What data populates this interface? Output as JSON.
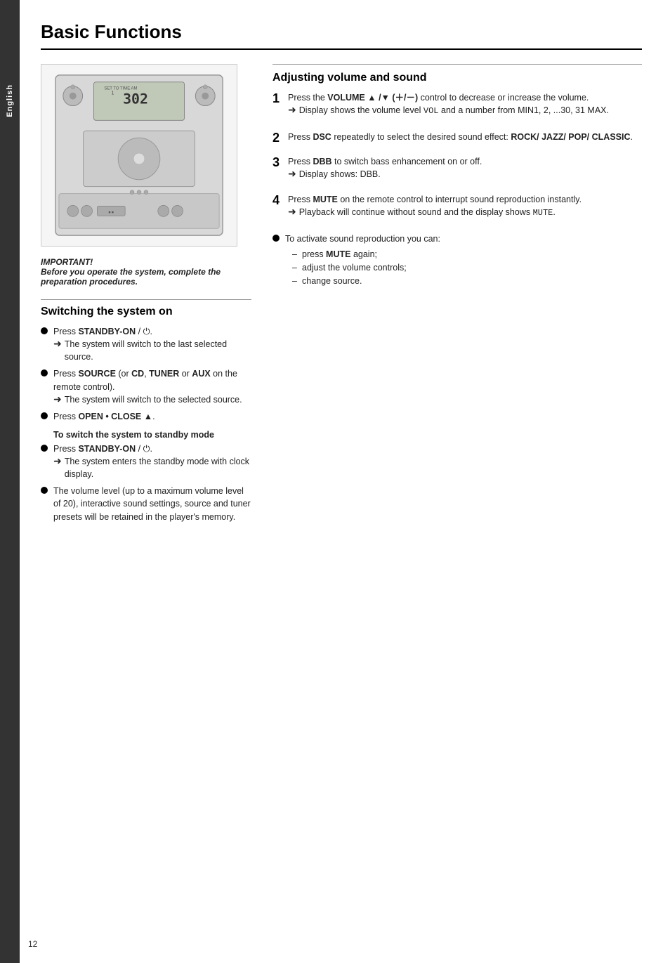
{
  "page": {
    "title": "Basic Functions",
    "number": "12",
    "language_tab": "English"
  },
  "left_column": {
    "important": {
      "title": "IMPORTANT!",
      "body": "Before you operate the system, complete the preparation procedures."
    },
    "switching_section": {
      "heading": "Switching the system on",
      "bullets": [
        {
          "text_parts": [
            {
              "text": "Press ",
              "bold": false
            },
            {
              "text": "STANDBY-ON",
              "bold": true
            },
            {
              "text": " / ⏻.",
              "bold": false
            }
          ],
          "arrow": "The system will switch to the last selected source."
        },
        {
          "text_parts": [
            {
              "text": "Press ",
              "bold": false
            },
            {
              "text": "SOURCE",
              "bold": true
            },
            {
              "text": " (or ",
              "bold": false
            },
            {
              "text": "CD",
              "bold": true
            },
            {
              "text": ", ",
              "bold": false
            },
            {
              "text": "TUNER",
              "bold": true
            },
            {
              "text": " or ",
              "bold": false
            },
            {
              "text": "AUX",
              "bold": true
            },
            {
              "text": " on the remote control).",
              "bold": false
            }
          ],
          "arrow": "The system will switch to the selected source."
        },
        {
          "text_parts": [
            {
              "text": "Press ",
              "bold": false
            },
            {
              "text": "OPEN • CLOSE",
              "bold": true
            },
            {
              "text": " ▲.",
              "bold": false
            }
          ],
          "arrow": null
        }
      ],
      "standby_subheading": "To switch the system to standby mode",
      "standby_bullets": [
        {
          "text_parts": [
            {
              "text": "Press ",
              "bold": false
            },
            {
              "text": "STANDBY-ON",
              "bold": true
            },
            {
              "text": " / ⏻.",
              "bold": false
            }
          ],
          "arrow": "The system enters the standby mode with clock display."
        },
        {
          "text_parts": [
            {
              "text": "The volume level (up to a maximum volume level of 20), interactive sound settings, source and tuner presets will be retained in the player's memory.",
              "bold": false
            }
          ],
          "arrow": null
        }
      ]
    }
  },
  "right_column": {
    "heading": "Adjusting volume and sound",
    "steps": [
      {
        "num": "1",
        "text_parts": [
          {
            "text": "Press the ",
            "bold": false
          },
          {
            "text": "VOLUME ▲ /▼ (＋/－)",
            "bold": true
          },
          {
            "text": " control to decrease or increase the volume.",
            "bold": false
          }
        ],
        "arrow": "Display shows the volume level VOL and a number from MIN1, 2, ...30, 31 MAX."
      },
      {
        "num": "2",
        "text_parts": [
          {
            "text": "Press ",
            "bold": false
          },
          {
            "text": "DSC",
            "bold": true
          },
          {
            "text": " repeatedly to select the desired sound effect: ",
            "bold": false
          },
          {
            "text": "ROCK/ JAZZ/ POP/ CLASSIC",
            "bold": true
          },
          {
            "text": ".",
            "bold": false
          }
        ],
        "arrow": null
      },
      {
        "num": "3",
        "text_parts": [
          {
            "text": "Press ",
            "bold": false
          },
          {
            "text": "DBB",
            "bold": true
          },
          {
            "text": " to switch bass enhancement on or off.",
            "bold": false
          }
        ],
        "arrow": "Display shows: DBB."
      },
      {
        "num": "4",
        "text_parts": [
          {
            "text": "Press ",
            "bold": false
          },
          {
            "text": "MUTE",
            "bold": true
          },
          {
            "text": " on the remote control to interrupt sound reproduction instantly.",
            "bold": false
          }
        ],
        "arrow": "Playback will continue without sound and the display shows MUTE."
      }
    ],
    "activate_bullet": {
      "intro": "To activate sound reproduction you can:",
      "dashes": [
        {
          "text_parts": [
            {
              "text": "press ",
              "bold": false
            },
            {
              "text": "MUTE",
              "bold": true
            },
            {
              "text": " again;",
              "bold": false
            }
          ]
        },
        {
          "text_parts": [
            {
              "text": "adjust the volume controls;",
              "bold": false
            }
          ]
        },
        {
          "text_parts": [
            {
              "text": "change source.",
              "bold": false
            }
          ]
        }
      ]
    }
  }
}
